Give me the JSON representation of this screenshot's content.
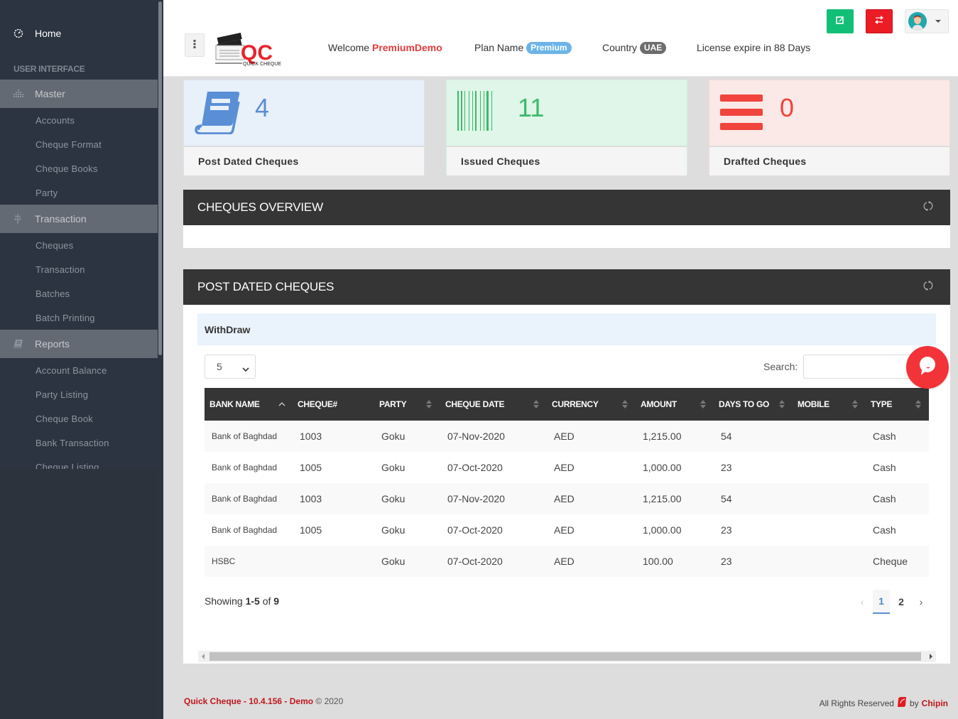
{
  "sidebar": {
    "home": {
      "label": "Home",
      "icon": "dashboard-icon"
    },
    "section_heading": "USER INTERFACE",
    "groups": [
      {
        "label": "Master",
        "icon": "bar-chart-icon",
        "items": [
          "Accounts",
          "Cheque Format",
          "Cheque Books",
          "Party"
        ]
      },
      {
        "label": "Transaction",
        "icon": "leaf-icon",
        "items": [
          "Cheques",
          "Transaction",
          "Batches",
          "Batch Printing"
        ]
      },
      {
        "label": "Reports",
        "icon": "book-icon",
        "items": [
          "Account Balance",
          "Party Listing",
          "Cheque Book",
          "Bank Transaction",
          "Cheque Listing"
        ]
      }
    ]
  },
  "header": {
    "menu_icon": "vertical-dots-icon",
    "logo_text": "QC",
    "logo_subtext": "QUICK CHEQUE",
    "welcome_label": "Welcome",
    "username": "PremiumDemo",
    "plan_label": "Plan Name",
    "plan_value": "Premium",
    "country_label": "Country",
    "country_value": "UAE",
    "license_text": "License expire in 88 Days",
    "edit_button_icon": "edit-icon",
    "switch_button_icon": "exchange-icon",
    "profile_menu_icon": "avatar-icon"
  },
  "stats": [
    {
      "value": "4",
      "label": "Post Dated Cheques",
      "icon": "book-icon",
      "color": "#5a8fd6"
    },
    {
      "value": "11",
      "label": "Issued Cheques",
      "icon": "barcode-icon",
      "color": "#3cb96a"
    },
    {
      "value": "0",
      "label": "Drafted Cheques",
      "icon": "bars-icon",
      "color": "#f0443c"
    }
  ],
  "overview_panel": {
    "title": "CHEQUES OVERVIEW",
    "refresh_icon": "refresh-icon"
  },
  "pdc_panel": {
    "title": "POST DATED CHEQUES",
    "refresh_icon": "refresh-icon",
    "tab_label": "WithDraw",
    "page_length": "5",
    "search_label": "Search:",
    "search_value": "",
    "columns": [
      "BANK NAME",
      "CHEQUE#",
      "PARTY",
      "CHEQUE DATE",
      "CURRENCY",
      "AMOUNT",
      "DAYS TO GO",
      "MOBILE",
      "TYPE"
    ],
    "rows": [
      [
        "Bank of Baghdad",
        "1003",
        "Goku",
        "07-Nov-2020",
        "AED",
        "1,215.00",
        "54",
        "",
        "Cash"
      ],
      [
        "Bank of Baghdad",
        "1005",
        "Goku",
        "07-Oct-2020",
        "AED",
        "1,000.00",
        "23",
        "",
        "Cash"
      ],
      [
        "Bank of Baghdad",
        "1003",
        "Goku",
        "07-Nov-2020",
        "AED",
        "1,215.00",
        "54",
        "",
        "Cash"
      ],
      [
        "Bank of Baghdad",
        "1005",
        "Goku",
        "07-Oct-2020",
        "AED",
        "1,000.00",
        "23",
        "",
        "Cash"
      ],
      [
        "HSBC",
        "",
        "Goku",
        "07-Oct-2020",
        "AED",
        "100.00",
        "23",
        "",
        "Cheque"
      ]
    ],
    "showing": {
      "prefix": "Showing",
      "range": "1-5",
      "of": "of",
      "total": "9"
    },
    "pagination": {
      "prev": "‹",
      "pages": [
        "1",
        "2"
      ],
      "current": "1",
      "next": "›"
    }
  },
  "chat_widget_icon": "chat-icon",
  "footer": {
    "brand": "Quick Cheque - 10.4.156 - Demo",
    "copyright": "© 2020",
    "rights": "All Rights Reserved",
    "by": "by",
    "company": "Chipin"
  }
}
